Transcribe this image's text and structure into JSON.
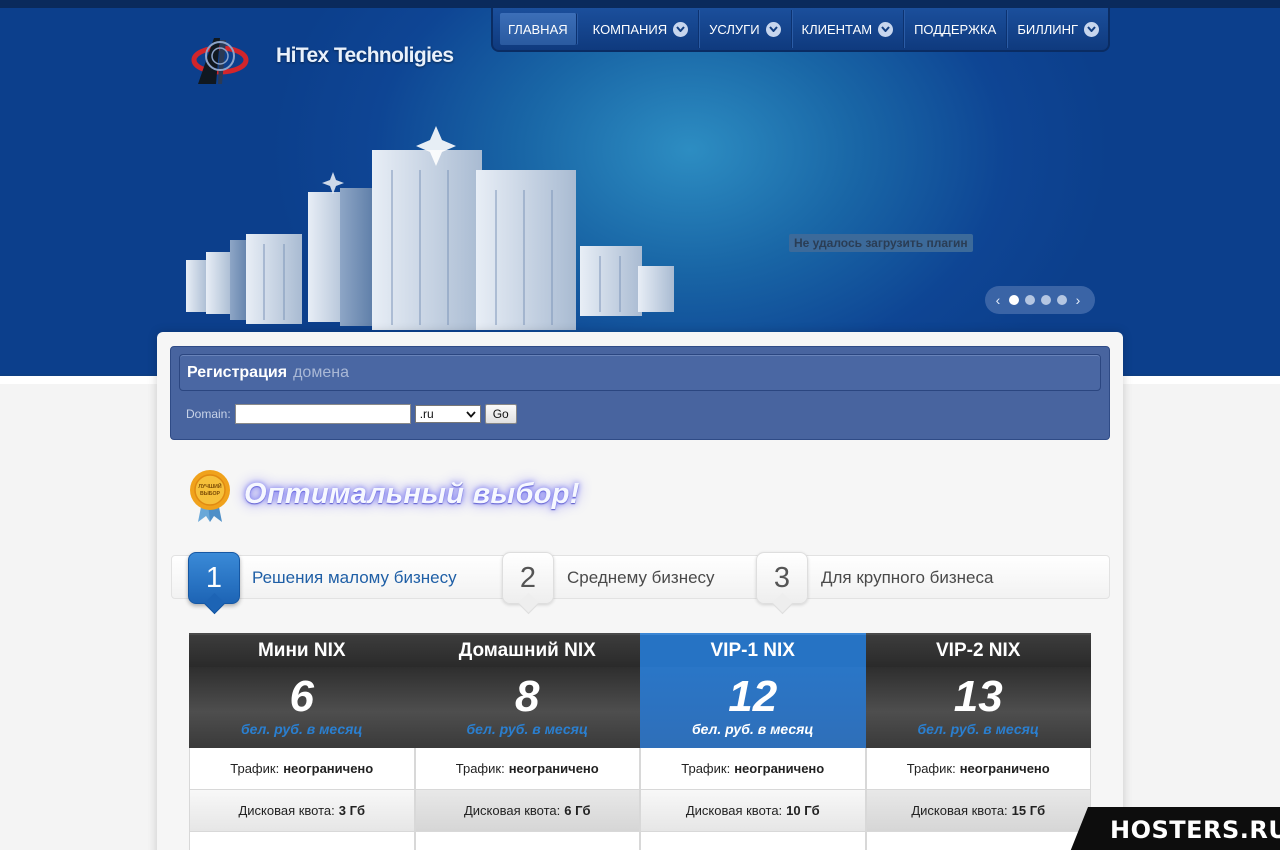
{
  "header": {
    "brand": "HiTex Technoligies",
    "plugin_message": "Не удалось загрузить плагин"
  },
  "nav": {
    "items": [
      {
        "label": "ГЛАВНАЯ",
        "has_dropdown": false,
        "active": true
      },
      {
        "label": "КОМПАНИЯ",
        "has_dropdown": true
      },
      {
        "label": "УСЛУГИ",
        "has_dropdown": true
      },
      {
        "label": "КЛИЕНТАМ",
        "has_dropdown": true
      },
      {
        "label": "ПОДДЕРЖКА",
        "has_dropdown": false
      },
      {
        "label": "БИЛЛИНГ",
        "has_dropdown": true
      }
    ]
  },
  "slider": {
    "prev": "‹",
    "next": "›",
    "dots": 4,
    "active_dot": 1
  },
  "domain": {
    "title_main": "Регистрация",
    "title_sub": "домена",
    "label": "Domain:",
    "input_value": "",
    "zone_selected": ".ru",
    "go_label": "Go"
  },
  "promo": {
    "badge_text": "ЛУЧШИЙ ВЫБОР",
    "title": "Оптимальный выбор!"
  },
  "tabs": [
    {
      "num": "1",
      "label": "Решения малому бизнесу",
      "active": true
    },
    {
      "num": "2",
      "label": "Среднему бизнесу",
      "active": false
    },
    {
      "num": "3",
      "label": "Для крупного бизнеса",
      "active": false
    }
  ],
  "plans": {
    "items": [
      {
        "name": "Мини NIX",
        "price": "6",
        "unit": "бел. руб. в месяц",
        "highlight": false
      },
      {
        "name": "Домашний NIX",
        "price": "8",
        "unit": "бел. руб. в месяц",
        "highlight": false
      },
      {
        "name": "VIP-1 NIX",
        "price": "12",
        "unit": "бел. руб. в месяц",
        "highlight": true
      },
      {
        "name": "VIP-2 NIX",
        "price": "13",
        "unit": "бел. руб. в месяц",
        "highlight": false
      }
    ],
    "features": [
      {
        "label": "Трафик:",
        "values": [
          "неограничено",
          "неограничено",
          "неограничено",
          "неограничено"
        ]
      },
      {
        "label": "Дисковая квота:",
        "values": [
          "3 Гб",
          "6 Гб",
          "10 Гб",
          "15 Гб"
        ]
      }
    ]
  },
  "watermark": {
    "text": "HOSTERS.RU"
  },
  "colors": {
    "banner": "#0e4594",
    "accent": "#2673c4",
    "domain_box": "#48649f"
  }
}
